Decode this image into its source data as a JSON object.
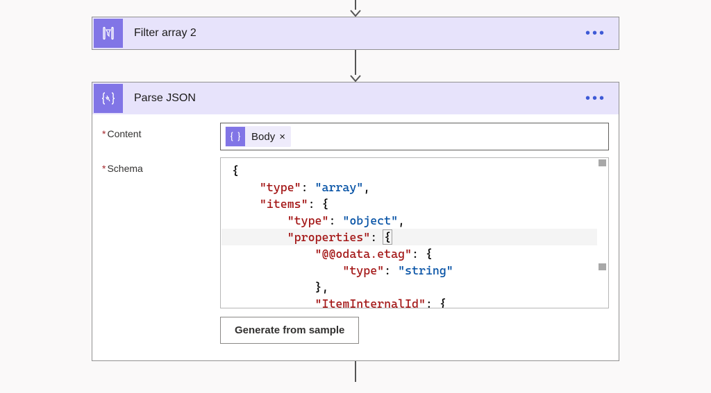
{
  "top_arrow": true,
  "filter_card": {
    "title": "Filter array 2"
  },
  "parse_card": {
    "title": "Parse JSON",
    "fields": {
      "content_label": "Content",
      "schema_label": "Schema"
    },
    "content_token": {
      "label": "Body",
      "close": "×"
    },
    "schema_lines": [
      {
        "text": "{",
        "indent": 0
      },
      {
        "indent": 1,
        "key": "\"type\"",
        "val": "\"array\"",
        "comma": true
      },
      {
        "indent": 1,
        "key": "\"items\"",
        "brace": "{"
      },
      {
        "indent": 2,
        "key": "\"type\"",
        "val": "\"object\"",
        "comma": true
      },
      {
        "indent": 2,
        "key": "\"properties\"",
        "brace": "{",
        "caret": true
      },
      {
        "indent": 3,
        "key": "\"@@odata.etag\"",
        "brace": "{"
      },
      {
        "indent": 4,
        "key": "\"type\"",
        "val": "\"string\""
      },
      {
        "indent": 3,
        "closebrace": "},",
        "plain": true
      },
      {
        "indent": 3,
        "key": "\"ItemInternalId\"",
        "brace": "{"
      }
    ],
    "generate_btn": "Generate from sample"
  }
}
